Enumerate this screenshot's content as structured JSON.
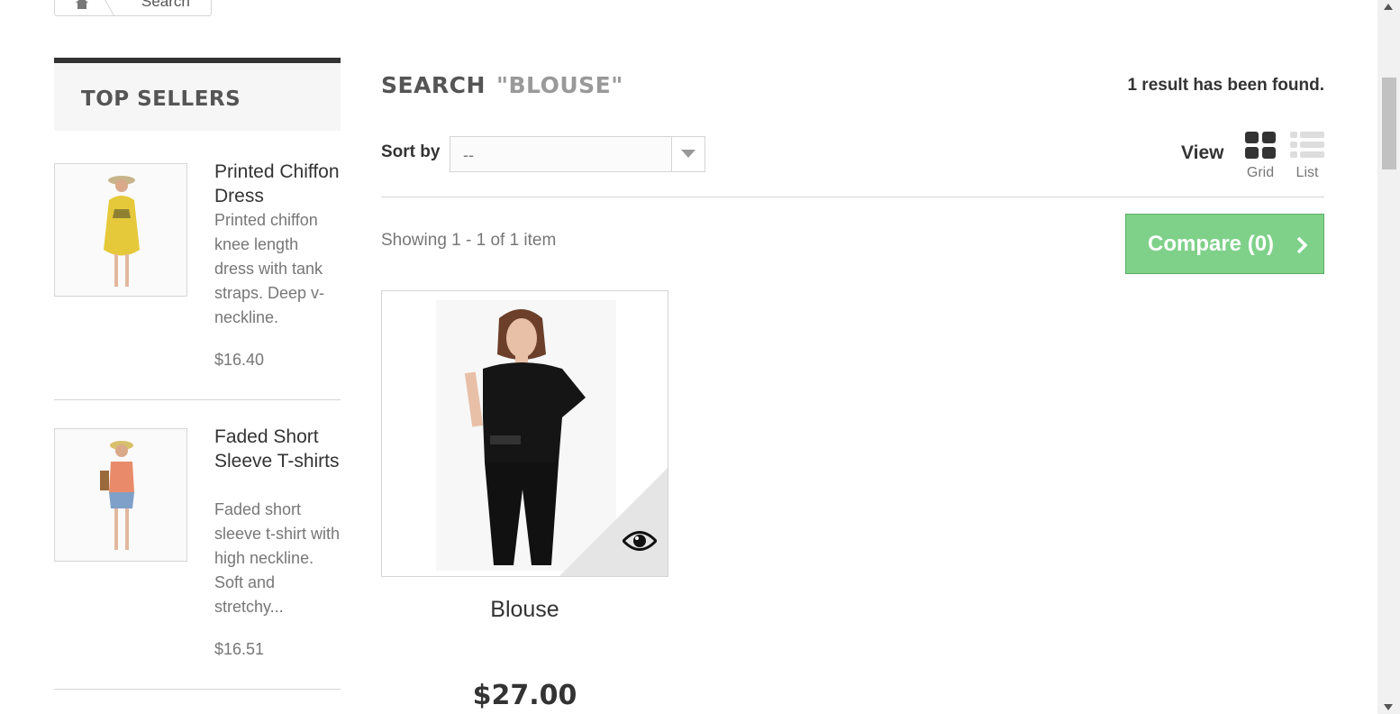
{
  "breadcrumb": {
    "current": "Search"
  },
  "sidebar": {
    "title": "TOP SELLERS",
    "items": [
      {
        "name": "Printed Chiffon Dress",
        "description": "Printed chiffon knee length dress with tank straps. Deep v-neckline.",
        "price": "$16.40"
      },
      {
        "name": "Faded Short Sleeve T-shirts",
        "description": "Faded short sleeve t-shirt with high neckline. Soft and stretchy...",
        "price": "$16.51"
      }
    ]
  },
  "search": {
    "title": "SEARCH",
    "query": "\"BLOUSE\"",
    "result_count": "1 result has been found."
  },
  "sort": {
    "label": "Sort by",
    "selected": "--"
  },
  "view": {
    "label": "View",
    "grid": "Grid",
    "list": "List"
  },
  "showing": "Showing 1 - 1 of 1 item",
  "compare": {
    "label": "Compare (0)"
  },
  "products": [
    {
      "name": "Blouse",
      "price": "$27.00"
    }
  ],
  "colors": {
    "accent_green": "#7fd18a",
    "dark": "#333333"
  }
}
